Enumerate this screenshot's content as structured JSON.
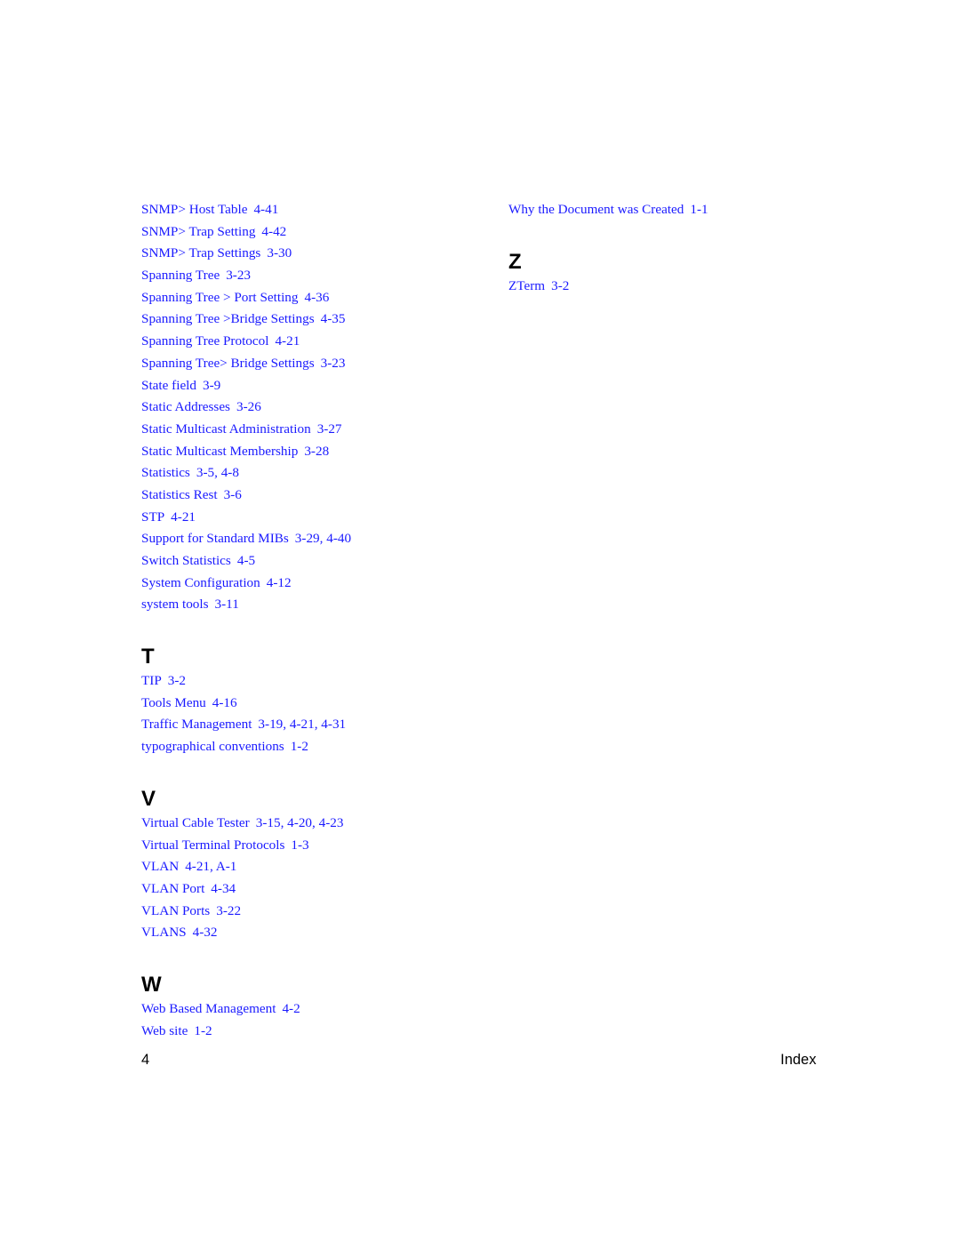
{
  "index": {
    "left_column": [
      {
        "letter": "",
        "entries": [
          {
            "term": "SNMP> Host Table",
            "pages": "4-41"
          },
          {
            "term": "SNMP> Trap Setting",
            "pages": "4-42"
          },
          {
            "term": "SNMP> Trap Settings",
            "pages": "3-30"
          },
          {
            "term": "Spanning Tree",
            "pages": "3-23"
          },
          {
            "term": "Spanning Tree > Port Setting",
            "pages": "4-36"
          },
          {
            "term": "Spanning Tree >Bridge Settings",
            "pages": "4-35"
          },
          {
            "term": "Spanning Tree Protocol",
            "pages": "4-21"
          },
          {
            "term": "Spanning Tree> Bridge Settings",
            "pages": "3-23"
          },
          {
            "term": "State field",
            "pages": "3-9"
          },
          {
            "term": "Static Addresses",
            "pages": "3-26"
          },
          {
            "term": "Static Multicast Administration",
            "pages": "3-27"
          },
          {
            "term": "Static Multicast Membership",
            "pages": "3-28"
          },
          {
            "term": "Statistics",
            "pages": "3-5, 4-8"
          },
          {
            "term": "Statistics Rest",
            "pages": "3-6"
          },
          {
            "term": "STP",
            "pages": "4-21"
          },
          {
            "term": "Support for Standard MIBs",
            "pages": "3-29, 4-40"
          },
          {
            "term": "Switch Statistics",
            "pages": "4-5"
          },
          {
            "term": "System Configuration",
            "pages": "4-12"
          },
          {
            "term": "system tools",
            "pages": "3-11"
          }
        ]
      },
      {
        "letter": "T",
        "entries": [
          {
            "term": "TIP",
            "pages": "3-2"
          },
          {
            "term": "Tools Menu",
            "pages": "4-16"
          },
          {
            "term": "Traffic Management",
            "pages": "3-19, 4-21, 4-31"
          },
          {
            "term": "typographical conventions",
            "pages": "1-2"
          }
        ]
      },
      {
        "letter": "V",
        "entries": [
          {
            "term": "Virtual Cable Tester",
            "pages": "3-15, 4-20, 4-23"
          },
          {
            "term": "Virtual Terminal Protocols",
            "pages": "1-3"
          },
          {
            "term": "VLAN",
            "pages": "4-21, A-1"
          },
          {
            "term": "VLAN Port",
            "pages": "4-34"
          },
          {
            "term": "VLAN Ports",
            "pages": "3-22"
          },
          {
            "term": "VLANS",
            "pages": "4-32"
          }
        ]
      },
      {
        "letter": "W",
        "entries": [
          {
            "term": "Web Based Management",
            "pages": "4-2"
          },
          {
            "term": "Web site",
            "pages": "1-2"
          }
        ]
      }
    ],
    "right_column": [
      {
        "letter": "",
        "entries": [
          {
            "term": "Why the Document was Created",
            "pages": "1-1"
          }
        ]
      },
      {
        "letter": "Z",
        "entries": [
          {
            "term": "ZTerm",
            "pages": "3-2"
          }
        ]
      }
    ]
  },
  "footer": {
    "page_number": "4",
    "section_title": "Index"
  }
}
